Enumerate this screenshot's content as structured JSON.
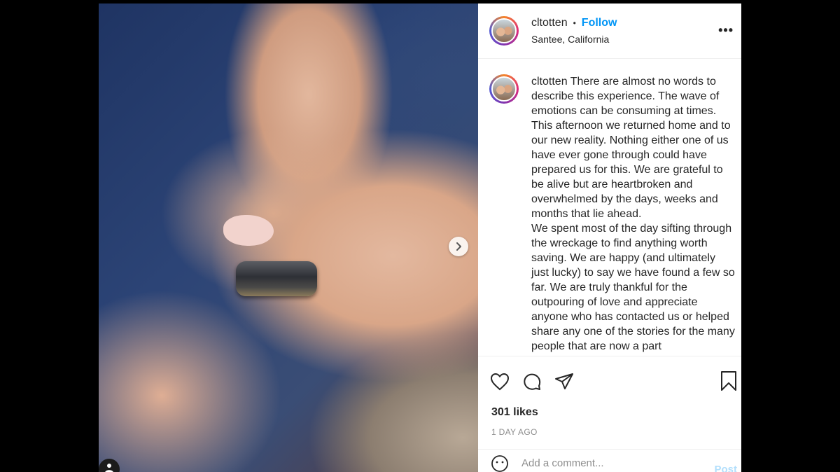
{
  "post": {
    "username": "cltotten",
    "follow_label": "Follow",
    "separator": "•",
    "location": "Santee, California",
    "more_label": "•••"
  },
  "caption": {
    "username": "cltotten",
    "text": "There are almost no words to describe this experience. The wave of emotions can be consuming at times. This afternoon we returned home and to our new reality. Nothing either one of us have ever gone through could have prepared us for this. We are grateful to be alive but are heartbroken and overwhelmed by the days, weeks and months that lie ahead.",
    "text2": "We spent most of the day sifting through the wreckage to find anything worth saving. We are happy (and ultimately just lucky) to say we have found a few so far. We are truly thankful for the outpouring of love and appreciate anyone who has contacted us or helped share any one of the stories for the many people that are now a part"
  },
  "engagement": {
    "likes": "301 likes",
    "time_ago": "1 DAY AGO"
  },
  "comment_box": {
    "placeholder": "Add a comment...",
    "post_label": "Post"
  },
  "icons": [
    "heart-icon",
    "comment-icon",
    "share-icon",
    "bookmark-icon",
    "chevron-right-icon",
    "emoji-icon",
    "user-tag-icon"
  ],
  "colors": {
    "follow": "#0095f6",
    "post_disabled": "#b2dffc",
    "muted": "#8e8e8e",
    "text": "#262626"
  }
}
